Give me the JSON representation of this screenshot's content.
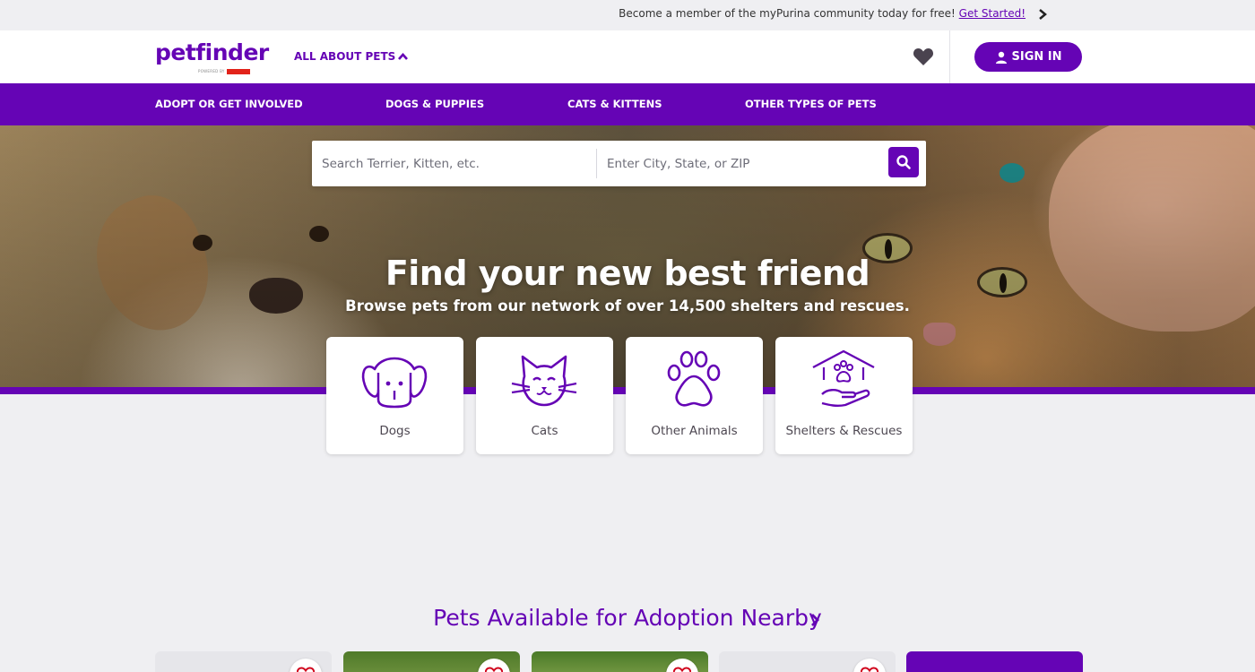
{
  "promo": {
    "text": "Become a member of the myPurina community today for free!",
    "link_label": "Get Started!"
  },
  "header": {
    "logo_text": "petfinder",
    "logo_powered": "POWERED BY",
    "about_pets_label": "ALL ABOUT PETS",
    "signin_label": "SIGN IN"
  },
  "nav": {
    "items": [
      {
        "label": "ADOPT OR GET INVOLVED"
      },
      {
        "label": "DOGS & PUPPIES"
      },
      {
        "label": "CATS & KITTENS"
      },
      {
        "label": "OTHER TYPES OF PETS"
      }
    ]
  },
  "search": {
    "pet_placeholder": "Search Terrier, Kitten, etc.",
    "location_placeholder": "Enter City, State, or ZIP"
  },
  "hero": {
    "title": "Find your new best friend",
    "subtitle": "Browse pets from our network of over 14,500 shelters and rescues."
  },
  "categories": [
    {
      "label": "Dogs",
      "icon": "dog-icon"
    },
    {
      "label": "Cats",
      "icon": "cat-icon"
    },
    {
      "label": "Other Animals",
      "icon": "paw-icon"
    },
    {
      "label": "Shelters & Rescues",
      "icon": "shelter-icon"
    }
  ],
  "nearby": {
    "title": "Pets Available for Adoption Nearby"
  },
  "colors": {
    "brand_purple": "#6504b5",
    "background": "#efeff2"
  }
}
